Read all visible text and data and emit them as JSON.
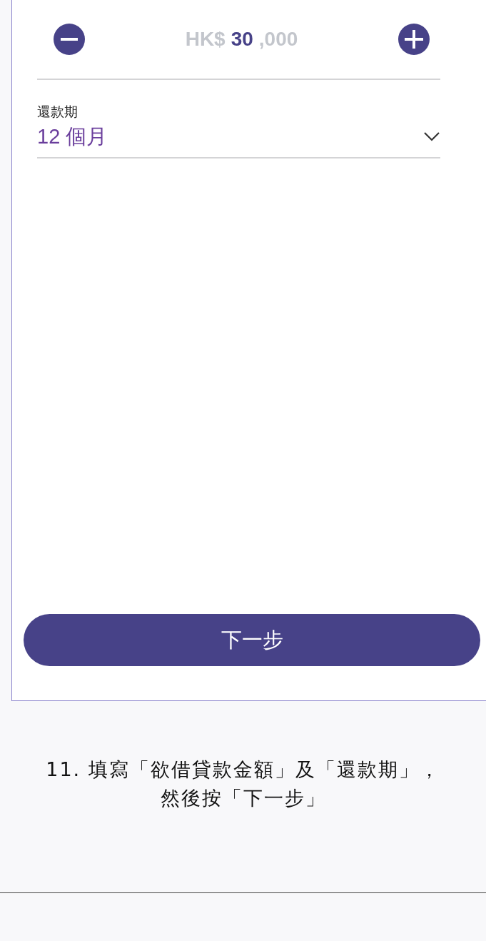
{
  "amount": {
    "currency": "HK$",
    "value_entered": "30",
    "value_rest": ",000"
  },
  "term": {
    "label": "還款期",
    "value": "12 個月"
  },
  "next_button": {
    "label": "下一步"
  },
  "caption": "11. 填寫「欲借貸款金額」及「還款期」，然後按「下一步」"
}
